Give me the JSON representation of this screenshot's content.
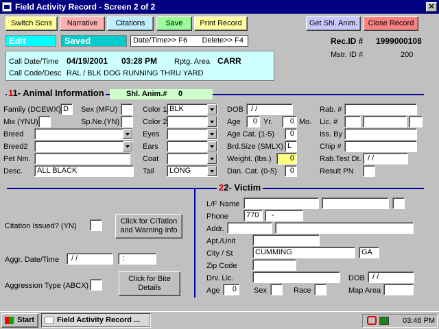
{
  "window": {
    "title": "Field Activity Record - Screen 2 of 2",
    "close": "✕"
  },
  "toolbar": {
    "switch": "Switch Scns",
    "narrative": "Narrative",
    "citations": "Citations",
    "save": "Save",
    "print": "Print Record",
    "get_shl": "Get Shl. Anim.",
    "close_record": "Close Record"
  },
  "status": {
    "edit": "Edit",
    "saved": "Saved",
    "hint": "Date/Time>> F6       Delete>> F4"
  },
  "record": {
    "rec_label": "Rec.ID #",
    "rec_value": "1999000108",
    "mstr_label": "Mstr. ID #",
    "mstr_value": "200"
  },
  "call": {
    "dt_label": "Call Date/Time",
    "date": "04/19/2001",
    "time": "03:28 PM",
    "area_label": "Rptg. Area",
    "area": "CARR",
    "code_label": "Call Code/Desc",
    "code": "RAL / BLK DOG RUNNING THRU YARD"
  },
  "animal": {
    "header": "1- Animal Information",
    "shl_label": "Shl. Anim.#",
    "shl_value": "0",
    "family_label": "Family (DCEWX)",
    "family": "D",
    "sex_label": "Sex (MFU)",
    "sex": "",
    "mix_label": "Mix (YNU)",
    "mix": "",
    "spne_label": "Sp.Ne.(YN)",
    "spne": "",
    "breed_label": "Breed",
    "breed": "",
    "breed2_label": "Breed2",
    "breed2": "",
    "pet_label": "Pet Nm.",
    "pet": "",
    "desc_label": "Desc.",
    "desc": "ALL BLACK",
    "color1_label": "Color 1",
    "color1": "BLK",
    "color2_label": "Color 2",
    "color2": "",
    "eyes_label": "Eyes",
    "eyes": "",
    "ears_label": "Ears",
    "ears": "",
    "coat_label": "Coat",
    "coat": "",
    "tail_label": "Tail",
    "tail": "LONG",
    "dob_label": "DOB",
    "dob": " / /",
    "age_label": "Age",
    "age_yr": "0",
    "yr_label": "Yr.",
    "age_mo": "0",
    "mo_label": "Mo.",
    "agecat_label": "Age Cat. (1-5)",
    "agecat": "0",
    "brd_label": "Brd.Size (SMLX)",
    "brd": "L",
    "weight_label": "Weight. (lbs.)",
    "weight": "0",
    "dan_label": "Dan. Cat. (0-5)",
    "dan": "0",
    "rab_label": "Rab. #",
    "lic_label": "Lic. #",
    "iss_label": "Iss. By",
    "chip_label": "Chip #",
    "rabtest_label": "Rab.Test Dt.",
    "rabtest": " / /",
    "result_label": "Result PN"
  },
  "left": {
    "citation_label": "Citation Issued? (YN)",
    "citation_btn": "Click for CiTation and Warning Info",
    "aggr_label": "Aggr. Date/Time",
    "aggr_date": " / /",
    "aggr_time": " :",
    "aggtype_label": "Aggression Type (ABCX)",
    "bite_btn": "Click for Bite Details"
  },
  "victim": {
    "header": "2- Victim",
    "name_label": "L/F Name",
    "phone_label": "Phone",
    "phone_area": "770",
    "phone_num": "  -",
    "addr_label": "Addr.",
    "apt_label": "Apt./Unit",
    "city_label": "City / St",
    "city": "CUMMING",
    "state": "GA",
    "zip_label": "Zip Code",
    "drv_label": "Drv. Lic.",
    "dob_label": "DOB",
    "dob": " / /",
    "age_label": "Age",
    "age": "0",
    "sex_label": "Sex",
    "race_label": "Race",
    "map_label": "Map Area"
  },
  "taskbar": {
    "start": "Start",
    "task": "Field Activity Record ...",
    "clock": "03:46 PM"
  }
}
